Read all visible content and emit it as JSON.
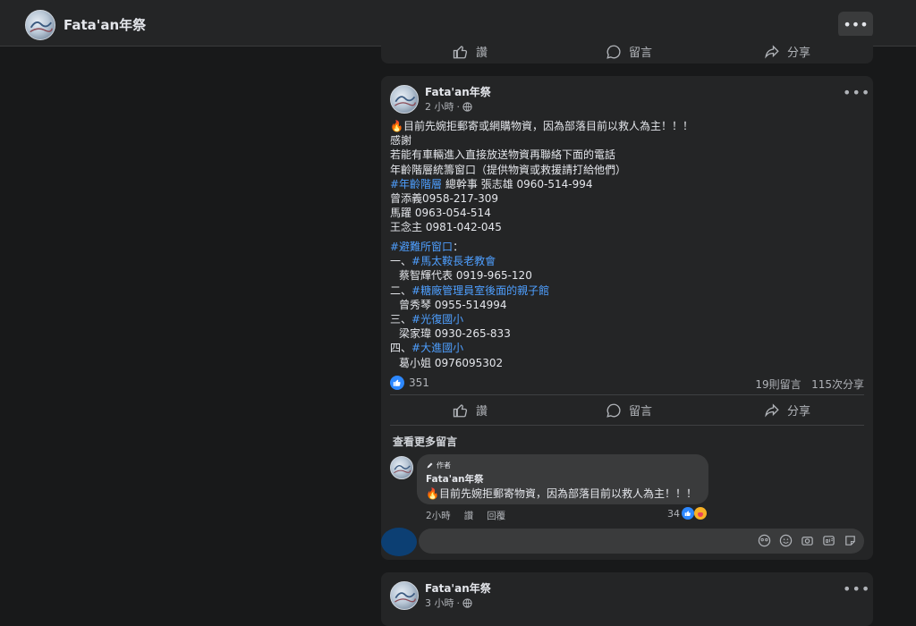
{
  "page": {
    "title": "Fata'an年祭"
  },
  "top_card": {
    "like": "讚",
    "comment": "留言",
    "share": "分享"
  },
  "post": {
    "author": "Fata'an年祭",
    "time": "2 小時",
    "lines": [
      {
        "text": "🔥目前先婉拒郵寄或網購物資，因為部落目前以救人為主！！！"
      },
      {
        "text": "感謝"
      },
      {
        "text": "若能有車輛進入直接放送物資再聯絡下面的電話"
      },
      {
        "text": "年齡階層統籌窗口（提供物資或救援請打給他們）"
      },
      {
        "tag": "#年齡階層",
        "text": " 總幹事 張志雄 0960-514-994"
      },
      {
        "text": "曾添義0958-217-309"
      },
      {
        "text": "馬躍 0963-054-514"
      },
      {
        "text": "王念主 0981-042-045"
      }
    ],
    "lines2": [
      {
        "tag": "#避難所窗口",
        "text": "："
      },
      {
        "prefix": "一、",
        "tag": "#馬太鞍長老教會",
        "text": ""
      },
      {
        "text": "蔡智輝代表 0919-965-120",
        "indent": true
      },
      {
        "prefix": "二、",
        "tag": "#糖廠管理員室後面的親子館",
        "text": ""
      },
      {
        "text": "曾秀琴  0955-514994",
        "indent": true
      },
      {
        "prefix": "三、",
        "tag": "#光復國小",
        "text": ""
      },
      {
        "text": "梁家瑋 0930-265-833",
        "indent": true
      },
      {
        "prefix": "四、",
        "tag": "#大進國小",
        "text": ""
      },
      {
        "text": "葛小姐 0976095302",
        "indent": true
      }
    ],
    "likes": "351",
    "comments_count": "19則留言",
    "shares_count": "115次分享",
    "like": "讚",
    "comment": "留言",
    "share": "分享",
    "more_comments": "查看更多留言",
    "top_comment": {
      "author_badge": "作者",
      "author": "Fata'an年祭",
      "text": "🔥目前先婉拒郵寄物資，因為部落目前以救人為主！！！",
      "time": "2小時",
      "like": "讚",
      "reply": "回覆",
      "reaction_count": "34"
    }
  },
  "post2": {
    "author": "Fata'an年祭",
    "time": "3 小時"
  },
  "colors": {
    "background": "#18191a",
    "card": "#242526",
    "link": "#4e9fff",
    "like_blue": "#2d88ff"
  },
  "icons": [
    "thumbs-up-icon",
    "comment-icon",
    "share-icon",
    "globe-icon",
    "more-icon",
    "pencil-icon",
    "emoji-icon",
    "camera-icon",
    "gif-icon",
    "sticker-icon"
  ]
}
